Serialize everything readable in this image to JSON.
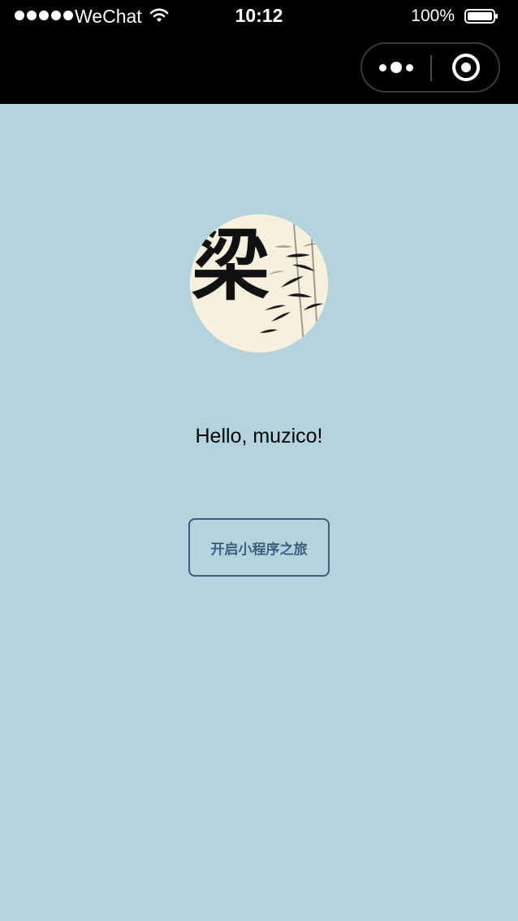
{
  "status_bar": {
    "carrier": "WeChat",
    "time": "10:12",
    "battery_percent": "100%",
    "signal_bars": 5,
    "icons": [
      "signal-icon",
      "wifi-icon",
      "battery-icon"
    ]
  },
  "nav_bar": {
    "menu_icon": "more-dots-icon",
    "close_icon": "target-close-icon"
  },
  "profile": {
    "avatar_char": "梁",
    "greeting": "Hello, muzico!"
  },
  "actions": {
    "start_label": "开启小程序之旅"
  },
  "colors": {
    "background": "#b3d4dc",
    "button_accent": "#3f5d80",
    "header": "#000000"
  }
}
